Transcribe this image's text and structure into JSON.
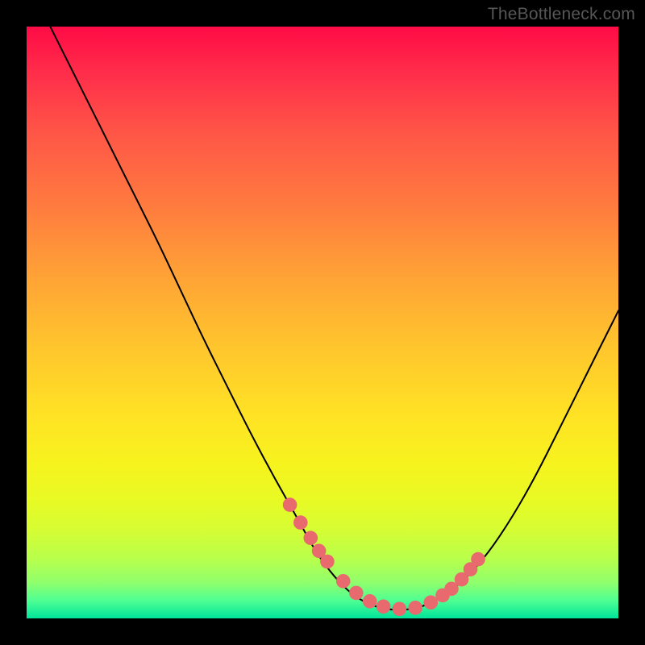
{
  "watermark": "TheBottleneck.com",
  "chart_data": {
    "type": "line",
    "title": "",
    "xlabel": "",
    "ylabel": "",
    "xlim": [
      0,
      100
    ],
    "ylim": [
      0,
      100
    ],
    "grid": false,
    "legend": false,
    "series": [
      {
        "name": "bottleneck-curve",
        "x": [
          3,
          6,
          10,
          14,
          18,
          22,
          26,
          30,
          34,
          38,
          42,
          46,
          49,
          52,
          55,
          58,
          61,
          64,
          67,
          70,
          74,
          78,
          82,
          86,
          90,
          94,
          98,
          100
        ],
        "y": [
          102,
          96,
          88,
          80,
          72,
          64,
          55.5,
          47,
          39,
          31,
          23.5,
          16.5,
          11,
          7,
          4,
          2.3,
          1.5,
          1.4,
          2,
          3.5,
          6.5,
          11,
          17,
          24,
          32,
          40,
          48,
          52
        ]
      }
    ],
    "markers": {
      "name": "highlight-dots",
      "x": [
        44.5,
        46.3,
        48.0,
        49.4,
        50.8,
        53.5,
        55.7,
        58.0,
        60.3,
        63.0,
        65.7,
        68.3,
        70.3,
        71.8,
        73.5,
        75.0,
        76.3
      ],
      "y": [
        19.2,
        16.2,
        13.6,
        11.4,
        9.6,
        6.3,
        4.3,
        2.9,
        2.0,
        1.6,
        1.8,
        2.7,
        3.9,
        5.0,
        6.6,
        8.3,
        10.0
      ],
      "radius_pct": 1.2
    },
    "background": {
      "type": "vertical-gradient",
      "stops": [
        {
          "pos": 0.0,
          "color": "#ff0b46"
        },
        {
          "pos": 0.3,
          "color": "#ff7a3f"
        },
        {
          "pos": 0.66,
          "color": "#ffe324"
        },
        {
          "pos": 0.9,
          "color": "#b8ff4c"
        },
        {
          "pos": 1.0,
          "color": "#00e39a"
        }
      ]
    }
  }
}
